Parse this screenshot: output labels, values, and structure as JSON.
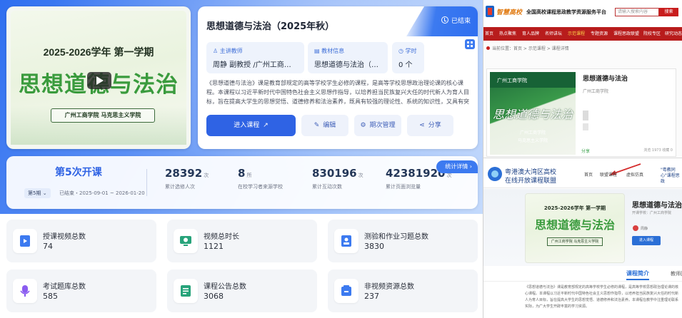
{
  "cover": {
    "semester": "2025-2026学年  第一学期",
    "course_name": "思想道德与法治",
    "school_line": "广州工商学院    马克思主义学院"
  },
  "course": {
    "title": "思想道德与法治（2025年秋）",
    "status": "已结束",
    "teacher_label": "主讲教师",
    "teacher_value": "周静 副教授 /广州工商学院",
    "material_label": "教材信息",
    "material_value": "思想道德与法治（2025年版）",
    "hours_label": "学时",
    "hours_value": "0 个",
    "description": "《思想道德与法治》课是教育部规定的高等学校学生必修的课程，是高等学校思想政治理论课的核心课程。本课程以习近平新时代中国特色社会主义思想作指导，以培养担当民族复兴大任的时代新人为育人目标，旨在提高大学生的思想觉悟、道德修养和法治素养，既具有较强的理论性、系统的知识性，又具有突出的实践性和教育性...",
    "buttons": {
      "enter": "进入课程",
      "edit": "编辑",
      "term": "期次管理",
      "share": "分享"
    }
  },
  "stats": {
    "open_title": "第5次开课",
    "term_select": "第5期",
    "term_status": "已结束・2025-09-01 ~ 2026-01-20",
    "detail_link": "统计详情",
    "items": [
      {
        "value": "28392",
        "unit": "次",
        "label": "累计选修人次"
      },
      {
        "value": "8",
        "unit": "所",
        "label": "在校学习者来源学校"
      },
      {
        "value": "830196",
        "unit": "次",
        "label": "累计互动次数"
      },
      {
        "value": "42381920",
        "unit": "次",
        "label": "累计页面浏览量"
      }
    ]
  },
  "resources": [
    {
      "label": "授课视频总数",
      "value": "74",
      "icon": "video-icon",
      "color": "#3c7af0"
    },
    {
      "label": "视频总时长",
      "value": "1121",
      "icon": "clock-screen-icon",
      "color": "#27a37a"
    },
    {
      "label": "测验和作业习题总数",
      "value": "3830",
      "icon": "quiz-icon",
      "color": "#3c7af0"
    },
    {
      "label": "考试题库总数",
      "value": "585",
      "icon": "exam-icon",
      "color": "#8a5cf0"
    },
    {
      "label": "课程公告总数",
      "value": "3068",
      "icon": "notice-icon",
      "color": "#27a37a"
    },
    {
      "label": "非视频资源总数",
      "value": "237",
      "icon": "resource-icon",
      "color": "#3c7af0"
    }
  ],
  "right_top": {
    "brand": "智慧高校",
    "platform": "全国高校课程思政教学资源服务平台",
    "search_placeholder": "请输入搜索内容",
    "search_button": "搜索",
    "nav": [
      "首页",
      "热点聚焦",
      "育人品牌",
      "名师讲坛",
      "示范课程",
      "专题资源",
      "课程思政联盟",
      "院校专区",
      "研究动态"
    ],
    "nav_active": "示范课程",
    "breadcrumb": "当前位置：首页 > 示范课程 > 课程详情",
    "card_university": "广州工商学院",
    "card_title": "思想道德与法治",
    "card_sub1": "广州工商学院",
    "card_sub2": "马克思主义学院",
    "course_title": "思想道德与法治",
    "course_school": "广州工商学院",
    "share": "分享",
    "stats": "浏览 1973  收藏 0"
  },
  "right_bottom": {
    "site_line1": "粤港澳大湾区高校",
    "site_line2": "在线开放课程联盟",
    "nav": [
      "首页",
      "联盟课程",
      "虚拟仿真"
    ],
    "nav_extra": "\"粤教同心\"课程思政",
    "cover_semester": "2025-2026学年  第一学期",
    "cover_course": "思想道德与法治",
    "cover_school": "广州工商学院  马克思主义学院",
    "course_title": "思想道德与法治",
    "course_meta": "开课学校：广州工商学院",
    "teacher": "周静",
    "enter_button": "进入课程",
    "tab_intro": "课程简介",
    "tab_other": "教师团队",
    "description": "《思想道德与法治》课是教育部规定的高等学校学生必修的课程，是高等学校思想政治理论课的核心课程。本课程以习近平新时代中国特色社会主义思想作指导，以培养担当民族复兴大任的时代新人为育人目标，旨在提高大学生的思想觉悟、道德修养和法治素养。本课程在教学中注重理论联系实际，为广大学生开辟丰富的学习资源。"
  }
}
